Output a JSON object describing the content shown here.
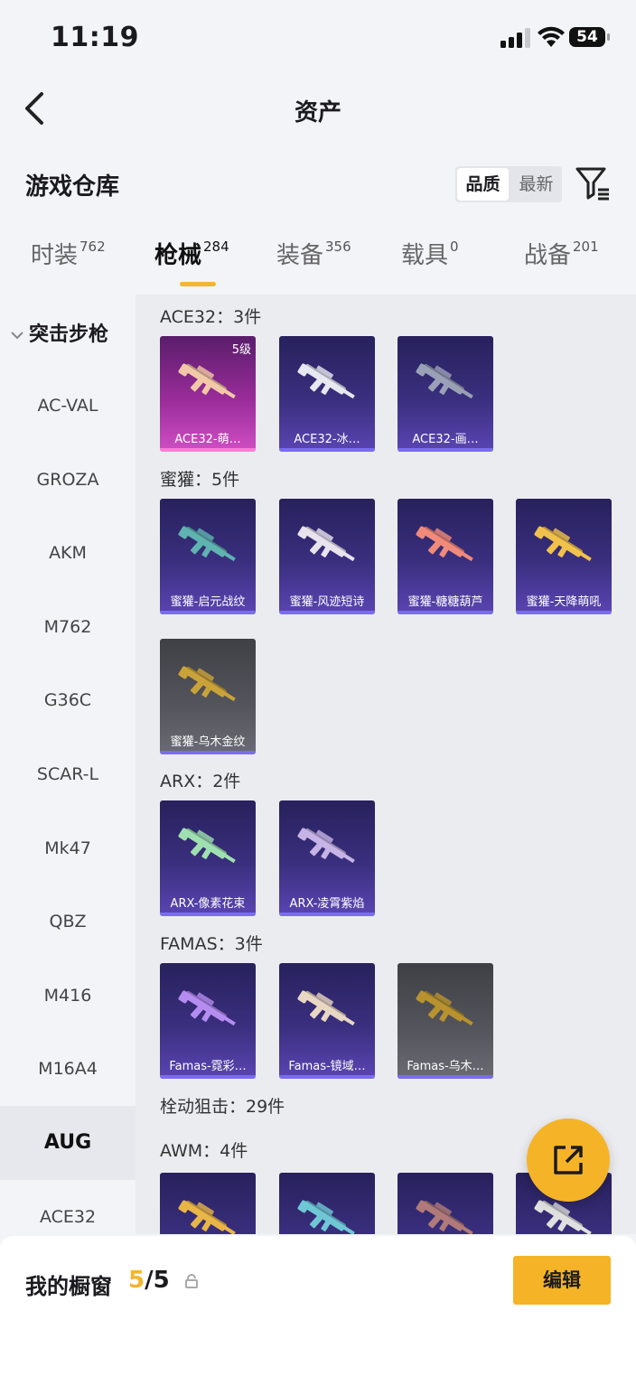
{
  "status_bar": {
    "time": "11:19",
    "battery": "54"
  },
  "nav": {
    "title": "资产"
  },
  "header": {
    "title": "游戏仓库",
    "sort": [
      "品质",
      "最新"
    ]
  },
  "tabs": [
    {
      "label": "时装",
      "count": "762"
    },
    {
      "label": "枪械",
      "count": "284"
    },
    {
      "label": "装备",
      "count": "356"
    },
    {
      "label": "载具",
      "count": "0"
    },
    {
      "label": "战备",
      "count": "201"
    }
  ],
  "sidebar": {
    "group": "突击步枪",
    "items": [
      "AC-VAL",
      "GROZA",
      "AKM",
      "M762",
      "G36C",
      "SCAR-L",
      "Mk47",
      "QBZ",
      "M416",
      "M16A4",
      "AUG",
      "ACE32"
    ]
  },
  "groups": [
    {
      "title": "ACE32：3件",
      "items": [
        {
          "name": "ACE32-萌…",
          "level": "5级",
          "quality": "pink",
          "gun": "#f2c9a8"
        },
        {
          "name": "ACE32-冰…",
          "quality": "purple",
          "gun": "#e6e8f2"
        },
        {
          "name": "ACE32-画…",
          "quality": "purple",
          "gun": "#9aa0b6"
        }
      ]
    },
    {
      "title": "蜜獾：5件",
      "items": [
        {
          "name": "蜜獾-启元战纹",
          "quality": "purple",
          "gun": "#5fb3b0"
        },
        {
          "name": "蜜獾-风迹短诗",
          "quality": "purple",
          "gun": "#e9e3ee"
        },
        {
          "name": "蜜獾-糖糖葫芦",
          "quality": "purple",
          "gun": "#f08a7a"
        },
        {
          "name": "蜜獾-天降萌吼",
          "quality": "purple",
          "gun": "#f1c24b"
        },
        {
          "name": "蜜獾-乌木金纹",
          "quality": "gray",
          "gun": "#c9a23a"
        }
      ]
    },
    {
      "title": "ARX：2件",
      "items": [
        {
          "name": "ARX-像素花束",
          "quality": "purple",
          "gun": "#9fe0b0"
        },
        {
          "name": "ARX-凌霄紫焰",
          "quality": "purple",
          "gun": "#c7b4e6"
        }
      ]
    },
    {
      "title": "FAMAS：3件",
      "items": [
        {
          "name": "Famas-霓彩…",
          "quality": "purple",
          "gun": "#b58cf0"
        },
        {
          "name": "Famas-镜域…",
          "quality": "purple",
          "gun": "#e8d7c2"
        },
        {
          "name": "Famas-乌木…",
          "quality": "gray",
          "gun": "#b8922f"
        }
      ]
    },
    {
      "title": "栓动狙击：29件",
      "items": []
    },
    {
      "title": "AWM：4件",
      "items": [
        {
          "name": "",
          "quality": "purple",
          "gun": "#e8b547"
        },
        {
          "name": "",
          "quality": "purple",
          "gun": "#6fc7d6"
        },
        {
          "name": "",
          "quality": "purple",
          "gun": "#b07a7a"
        },
        {
          "name": "",
          "quality": "purple",
          "gun": "#e0e0e0"
        }
      ]
    }
  ],
  "bottom": {
    "label": "我的橱窗",
    "current": "5",
    "total": "/5",
    "edit": "编辑"
  },
  "colors": {
    "accent": "#f3b62c",
    "purple": "#3a2f7f",
    "pink": "#9a2c9a"
  }
}
